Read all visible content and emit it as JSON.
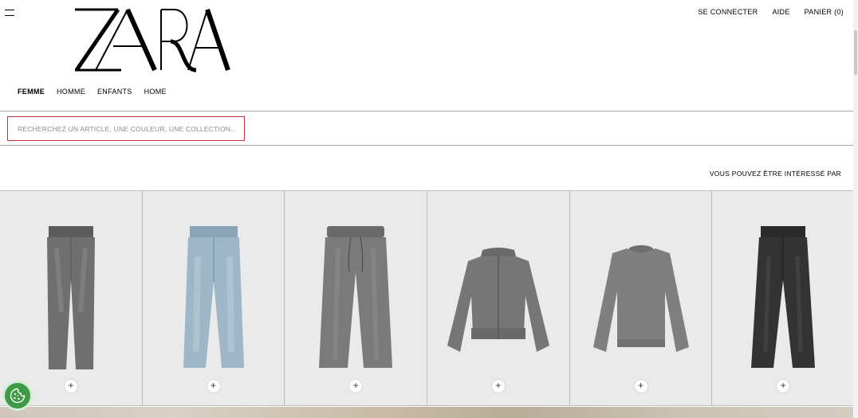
{
  "brand": {
    "logo_text": "ZARA"
  },
  "header": {
    "menu_icon": "hamburger-icon",
    "links": [
      {
        "id": "login",
        "label": "SE CONNECTER"
      },
      {
        "id": "help",
        "label": "AIDE"
      },
      {
        "id": "cart",
        "label": "PANIER (0)"
      }
    ]
  },
  "categories": [
    {
      "label": "FEMME",
      "active": true
    },
    {
      "label": "HOMME",
      "active": false
    },
    {
      "label": "ENFANTS",
      "active": false
    },
    {
      "label": "HOME",
      "active": false
    }
  ],
  "search": {
    "placeholder": "RECHERCHEZ UN ARTICLE, UNE COULEUR, UNE COLLECTION..."
  },
  "recommendations": {
    "heading": "VOUS POUVEZ ÊTRE INTÉRESSÉ PAR",
    "items": [
      {
        "icon": "grey-jeans",
        "add_label": "+"
      },
      {
        "icon": "light-blue-jeans",
        "add_label": "+"
      },
      {
        "icon": "grey-jogger-pants",
        "add_label": "+"
      },
      {
        "icon": "grey-bomber-jacket",
        "add_label": "+"
      },
      {
        "icon": "grey-knit-sweater",
        "add_label": "+"
      },
      {
        "icon": "black-jeans",
        "add_label": "+"
      }
    ]
  },
  "cookie": {
    "icon": "cookie-icon"
  },
  "colors": {
    "search_border": "#c0343a",
    "card_bg": "#eaeaea",
    "cookie_green": "#3f9a45"
  }
}
